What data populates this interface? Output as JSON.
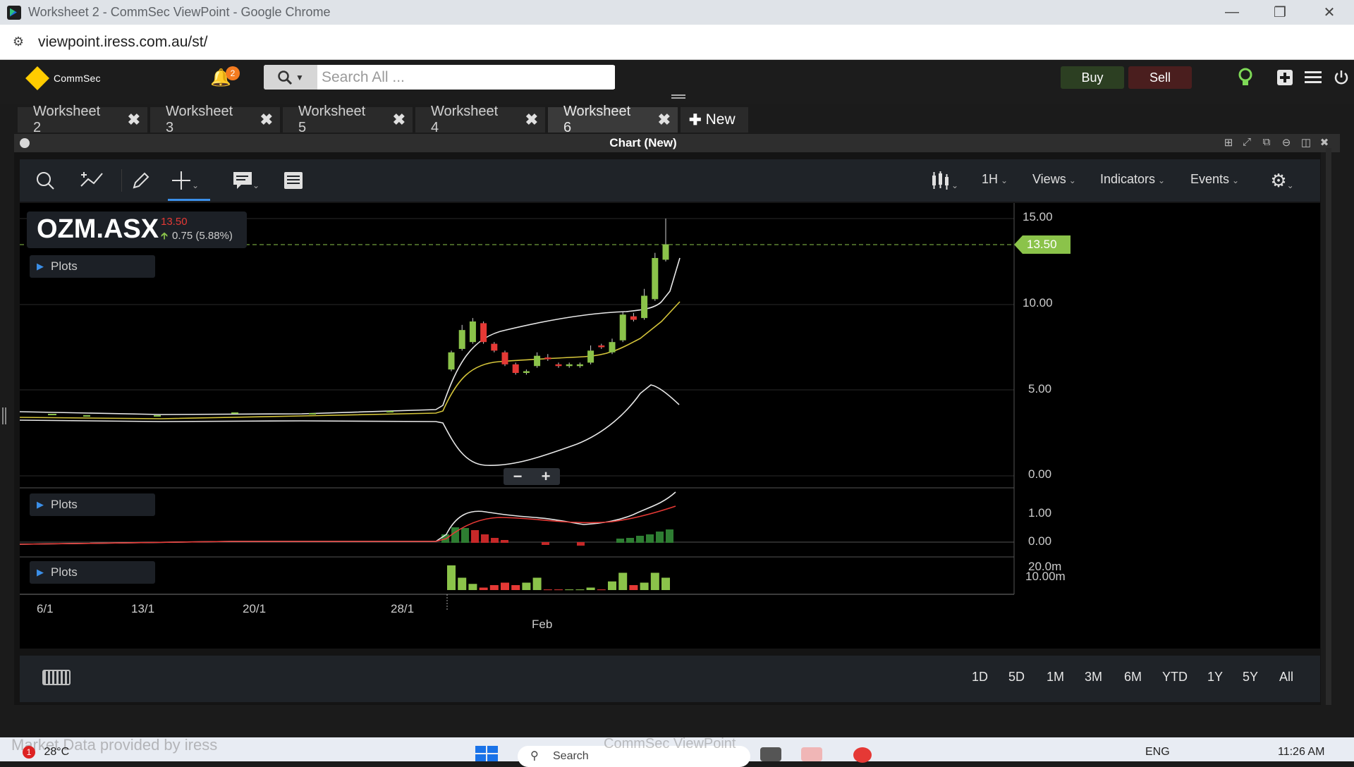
{
  "browser": {
    "window_title": "Worksheet 2 - CommSec ViewPoint - Google Chrome",
    "url": "viewpoint.iress.com.au/st/"
  },
  "header": {
    "logo_text": "CommSec",
    "notification_count": "2",
    "search_placeholder": "Search All ...",
    "buy_label": "Buy",
    "sell_label": "Sell"
  },
  "tabs": [
    {
      "label": "Worksheet 2",
      "active": false
    },
    {
      "label": "Worksheet 3",
      "active": false
    },
    {
      "label": "Worksheet 5",
      "active": false
    },
    {
      "label": "Worksheet 4",
      "active": false
    },
    {
      "label": "Worksheet 6",
      "active": true
    }
  ],
  "new_tab_label": "New",
  "panel": {
    "title": "Chart (New)"
  },
  "toolbar": {
    "interval": "1H",
    "views": "Views",
    "indicators": "Indicators",
    "events": "Events"
  },
  "quote": {
    "symbol": "OZM.ASX",
    "price": "13.50",
    "change": "0.75 (5.88%)",
    "direction": "up"
  },
  "plots_label": "Plots",
  "price_axis": {
    "ticks": [
      "15.00",
      "10.00",
      "5.00",
      "0.00"
    ],
    "last_price_tag": "13.50"
  },
  "macd_axis": {
    "ticks": [
      "1.00",
      "0.00"
    ]
  },
  "volume_axis": {
    "ticks": [
      "20.0m",
      "10.00m"
    ]
  },
  "time_axis": {
    "ticks": [
      "6/1",
      "13/1",
      "20/1",
      "28/1",
      "Feb"
    ]
  },
  "zoom": {
    "minus": "−",
    "plus": "+"
  },
  "ranges": [
    "1D",
    "5D",
    "1M",
    "3M",
    "6M",
    "YTD",
    "1Y",
    "5Y",
    "All"
  ],
  "footer": {
    "watermark": "Market Data provided by iress"
  },
  "taskbar": {
    "weather_badge": "1",
    "temperature": "28°C",
    "search_label": "Search",
    "center_text": "CommSec ViewPoint",
    "language": "ENG",
    "time": "11:26 AM"
  },
  "colors": {
    "up_candle": "#8bc34a",
    "down_candle": "#e53935",
    "band_line": "#e8e8e8",
    "ma_line": "#d4c43a",
    "macd_signal": "#e53935",
    "price_tag": "#8bc34a",
    "toolbar_accent": "#3b8fe8"
  },
  "chart_data": {
    "type": "candlestick",
    "symbol": "OZM.ASX",
    "interval": "1H",
    "price_ylim": [
      0,
      15
    ],
    "last_price": 13.5,
    "candles": [
      {
        "o": 6.2,
        "h": 7.3,
        "l": 6.1,
        "c": 7.2
      },
      {
        "o": 7.4,
        "h": 8.8,
        "l": 7.3,
        "c": 8.5
      },
      {
        "o": 7.8,
        "h": 9.2,
        "l": 7.7,
        "c": 9.0
      },
      {
        "o": 8.9,
        "h": 9.0,
        "l": 7.7,
        "c": 7.8
      },
      {
        "o": 7.7,
        "h": 7.8,
        "l": 7.2,
        "c": 7.3
      },
      {
        "o": 7.2,
        "h": 7.3,
        "l": 6.4,
        "c": 6.5
      },
      {
        "o": 6.5,
        "h": 6.6,
        "l": 5.9,
        "c": 6.0
      },
      {
        "o": 6.0,
        "h": 6.2,
        "l": 5.9,
        "c": 6.1
      },
      {
        "o": 6.4,
        "h": 7.2,
        "l": 6.3,
        "c": 7.0
      },
      {
        "o": 6.9,
        "h": 7.1,
        "l": 6.7,
        "c": 6.8
      },
      {
        "o": 6.5,
        "h": 6.6,
        "l": 6.3,
        "c": 6.4
      },
      {
        "o": 6.4,
        "h": 6.6,
        "l": 6.3,
        "c": 6.5
      },
      {
        "o": 6.4,
        "h": 6.6,
        "l": 6.3,
        "c": 6.5
      },
      {
        "o": 6.6,
        "h": 7.6,
        "l": 6.5,
        "c": 7.3
      },
      {
        "o": 7.6,
        "h": 7.7,
        "l": 7.4,
        "c": 7.5
      },
      {
        "o": 7.2,
        "h": 8.0,
        "l": 7.1,
        "c": 7.8
      },
      {
        "o": 7.9,
        "h": 9.6,
        "l": 7.8,
        "c": 9.4
      },
      {
        "o": 9.3,
        "h": 9.5,
        "l": 9.0,
        "c": 9.1
      },
      {
        "o": 9.2,
        "h": 10.9,
        "l": 9.1,
        "c": 10.5
      },
      {
        "o": 10.3,
        "h": 13.0,
        "l": 10.2,
        "c": 12.7
      },
      {
        "o": 12.6,
        "h": 15.0,
        "l": 12.5,
        "c": 13.5
      }
    ],
    "volume_ylim": [
      0,
      20
    ],
    "volume_unit": "m",
    "volume": [
      20,
      10,
      5,
      2,
      4,
      6,
      4,
      6,
      10,
      0.5,
      0.5,
      0.5,
      0.5,
      2,
      0.5,
      7,
      14,
      4,
      6,
      14,
      10
    ]
  }
}
